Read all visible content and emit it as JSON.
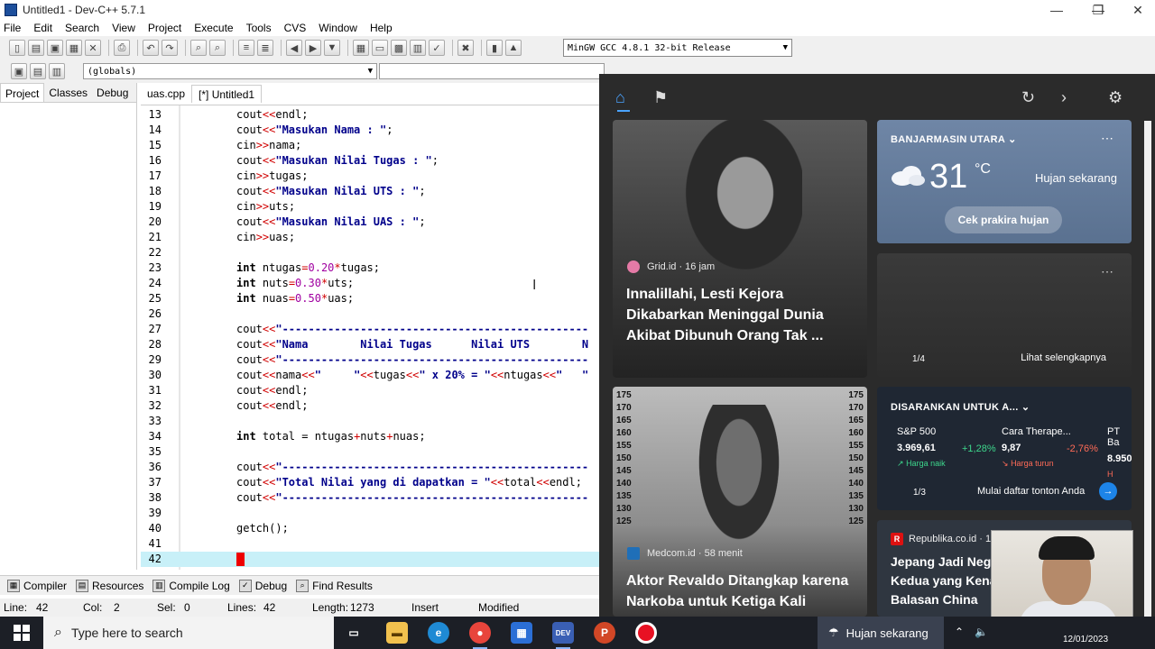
{
  "window": {
    "title": "Untitled1 - Dev-C++ 5.7.1",
    "minimize": "—",
    "maximize": "❐",
    "close": "✕"
  },
  "menu": [
    "File",
    "Edit",
    "Search",
    "View",
    "Project",
    "Execute",
    "Tools",
    "CVS",
    "Window",
    "Help"
  ],
  "toolbar": {
    "compiler": "MinGW GCC 4.8.1 32-bit Release",
    "scope": "(globals)"
  },
  "left_tabs": [
    "Project",
    "Classes",
    "Debug"
  ],
  "editor_tabs": [
    "uas.cpp",
    "[*] Untitled1"
  ],
  "code_lines": [
    {
      "n": "13",
      "html": "cout<span class=\"op\">&lt;&lt;</span>endl;"
    },
    {
      "n": "14",
      "html": "cout<span class=\"op\">&lt;&lt;</span><span class=\"str\">\"Masukan Nama : \"</span>;"
    },
    {
      "n": "15",
      "html": "cin<span class=\"op\">&gt;&gt;</span>nama;"
    },
    {
      "n": "16",
      "html": "cout<span class=\"op\">&lt;&lt;</span><span class=\"str\">\"Masukan Nilai Tugas : \"</span>;"
    },
    {
      "n": "17",
      "html": "cin<span class=\"op\">&gt;&gt;</span>tugas;"
    },
    {
      "n": "18",
      "html": "cout<span class=\"op\">&lt;&lt;</span><span class=\"str\">\"Masukan Nilai UTS : \"</span>;"
    },
    {
      "n": "19",
      "html": "cin<span class=\"op\">&gt;&gt;</span>uts;"
    },
    {
      "n": "20",
      "html": "cout<span class=\"op\">&lt;&lt;</span><span class=\"str\">\"Masukan Nilai UAS : \"</span>;"
    },
    {
      "n": "21",
      "html": "cin<span class=\"op\">&gt;&gt;</span>uas;"
    },
    {
      "n": "22",
      "html": ""
    },
    {
      "n": "23",
      "html": "<span class=\"kw\">int</span> ntugas<span class=\"op\">=</span><span class=\"num\">0.20</span><span class=\"op\">*</span>tugas;"
    },
    {
      "n": "24",
      "html": "<span class=\"kw\">int</span> nuts<span class=\"op\">=</span><span class=\"num\">0.30</span><span class=\"op\">*</span>uts;"
    },
    {
      "n": "25",
      "html": "<span class=\"kw\">int</span> nuas<span class=\"op\">=</span><span class=\"num\">0.50</span><span class=\"op\">*</span>uas;"
    },
    {
      "n": "26",
      "html": ""
    },
    {
      "n": "27",
      "html": "cout<span class=\"op\">&lt;&lt;</span><span class=\"str\">\"-----------------------------------------------</span>"
    },
    {
      "n": "28",
      "html": "cout<span class=\"op\">&lt;&lt;</span><span class=\"str\">\"Nama        Nilai Tugas      Nilai UTS        N</span>"
    },
    {
      "n": "29",
      "html": "cout<span class=\"op\">&lt;&lt;</span><span class=\"str\">\"-----------------------------------------------</span>"
    },
    {
      "n": "30",
      "html": "cout<span class=\"op\">&lt;&lt;</span>nama<span class=\"op\">&lt;&lt;</span><span class=\"str\">\"     \"</span><span class=\"op\">&lt;&lt;</span>tugas<span class=\"op\">&lt;&lt;</span><span class=\"str\">\" x 20% = \"</span><span class=\"op\">&lt;&lt;</span>ntugas<span class=\"op\">&lt;&lt;</span><span class=\"str\">\"   \"</span>"
    },
    {
      "n": "31",
      "html": "cout<span class=\"op\">&lt;&lt;</span>endl;"
    },
    {
      "n": "32",
      "html": "cout<span class=\"op\">&lt;&lt;</span>endl;"
    },
    {
      "n": "33",
      "html": ""
    },
    {
      "n": "34",
      "html": "<span class=\"kw\">int</span> total = ntugas<span class=\"op\">+</span>nuts<span class=\"op\">+</span>nuas;"
    },
    {
      "n": "35",
      "html": ""
    },
    {
      "n": "36",
      "html": "cout<span class=\"op\">&lt;&lt;</span><span class=\"str\">\"-----------------------------------------------</span>"
    },
    {
      "n": "37",
      "html": "cout<span class=\"op\">&lt;&lt;</span><span class=\"str\">\"Total Nilai yang di dapatkan = \"</span><span class=\"op\">&lt;&lt;</span>total<span class=\"op\">&lt;&lt;</span>endl;"
    },
    {
      "n": "38",
      "html": "cout<span class=\"op\">&lt;&lt;</span><span class=\"str\">\"-----------------------------------------------</span>"
    },
    {
      "n": "39",
      "html": ""
    },
    {
      "n": "40",
      "html": "getch();"
    },
    {
      "n": "41",
      "html": ""
    },
    {
      "n": "42",
      "html": "<span class=\"cursor-caret\"></span>"
    }
  ],
  "bottom_tabs": [
    "Compiler",
    "Resources",
    "Compile Log",
    "Debug",
    "Find Results"
  ],
  "status": {
    "line_label": "Line:",
    "line": "42",
    "col_label": "Col:",
    "col": "2",
    "sel_label": "Sel:",
    "sel": "0",
    "lines_label": "Lines:",
    "lines": "42",
    "length_label": "Length:",
    "length": "1273",
    "mode": "Insert",
    "modified": "Modified"
  },
  "news": {
    "card1": {
      "source": "Grid.id · 16 jam",
      "headline": "Innalillahi, Lesti Kejora Dikabarkan Meninggal Dunia Akibat Dibunuh Orang Tak ..."
    },
    "weather": {
      "location": "BANJARMASIN UTARA",
      "temp": "31",
      "unit": "°C",
      "condition": "Hujan sekarang",
      "button": "Cek prakira hujan"
    },
    "slideshow": {
      "page": "1/4",
      "more": "Lihat selengkapnya"
    },
    "card2": {
      "source": "Medcom.id · 58 menit",
      "headline": "Aktor Revaldo Ditangkap karena Narkoba untuk Ketiga Kali"
    },
    "stocks": {
      "header": "DISARANKAN UNTUK A...",
      "items": [
        {
          "name": "S&P 500",
          "value": "3.969,61",
          "change": "+1,28%",
          "trend": "Harga naik"
        },
        {
          "name": "Cara Therape...",
          "value": "9,87",
          "change": "-2,76%",
          "trend": "Harga turun"
        },
        {
          "name": "PT Ba",
          "value": "8.950",
          "change": "",
          "trend": "H"
        }
      ],
      "page": "1/3",
      "cta": "Mulai daftar tonton Anda"
    },
    "card3": {
      "source": "Republika.co.id · 1",
      "headline": "Jepang Jadi Negara Kedua yang Kena Balasan China"
    }
  },
  "scale_labels": [
    "175",
    "170",
    "165",
    "160",
    "155",
    "150",
    "145",
    "140",
    "135",
    "130",
    "125"
  ],
  "taskbar": {
    "search_placeholder": "Type here to search",
    "weather": "Hujan sekarang",
    "date": "12/01/2023"
  },
  "colors": {
    "accent": "#4aa3ff",
    "up": "#3dd68c",
    "down": "#ff6b57"
  }
}
